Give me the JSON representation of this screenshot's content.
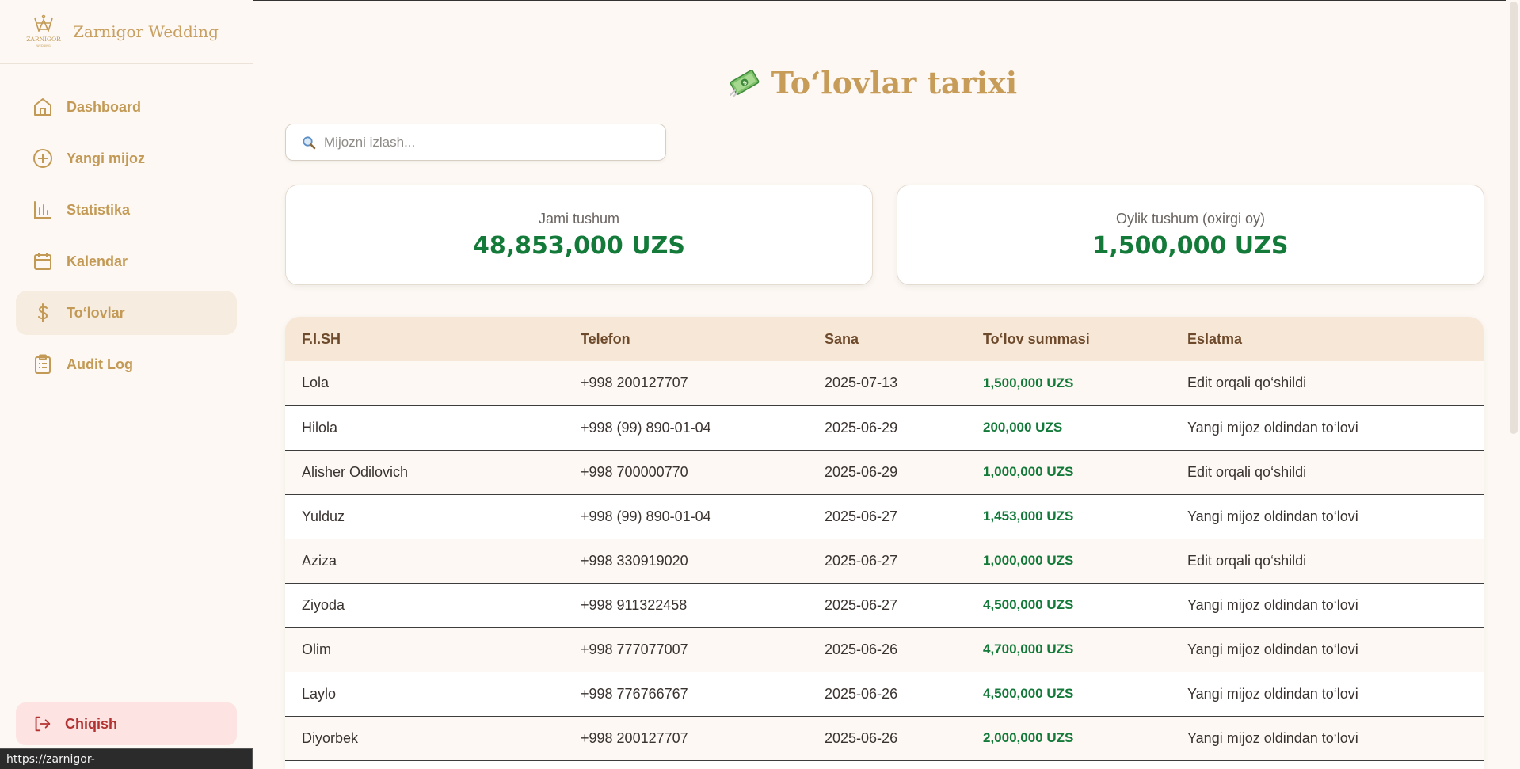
{
  "brand": {
    "name": "Zarnigor Wedding",
    "logo_text": "ZARNIGOR"
  },
  "nav": [
    {
      "label": "Dashboard",
      "icon": "home-icon"
    },
    {
      "label": "Yangi mijoz",
      "icon": "plus-circle-icon"
    },
    {
      "label": "Statistika",
      "icon": "bar-chart-icon"
    },
    {
      "label": "Kalendar",
      "icon": "calendar-icon"
    },
    {
      "label": "To‘lovlar",
      "icon": "dollar-icon",
      "active": true
    },
    {
      "label": "Audit Log",
      "icon": "clipboard-icon"
    }
  ],
  "logout": {
    "label": "Chiqish"
  },
  "status_url": "https://zarnigor-wedding.vercel.app/payments",
  "page": {
    "title": "To‘lovlar tarixi"
  },
  "search": {
    "placeholder": "Mijozni izlash..."
  },
  "stats": {
    "total": {
      "label": "Jami tushum",
      "value": "48,853,000 UZS"
    },
    "monthly": {
      "label": "Oylik tushum (oxirgi oy)",
      "value": "1,500,000 UZS"
    }
  },
  "table": {
    "headers": [
      "F.I.SH",
      "Telefon",
      "Sana",
      "To‘lov summasi",
      "Eslatma"
    ],
    "rows": [
      [
        "Lola",
        "+998 200127707",
        "2025-07-13",
        "1,500,000 UZS",
        "Edit orqali qo‘shildi"
      ],
      [
        "Hilola",
        "+998 (99) 890-01-04",
        "2025-06-29",
        "200,000 UZS",
        "Yangi mijoz oldindan to‘lovi"
      ],
      [
        "Alisher Odilovich",
        "+998 700000770",
        "2025-06-29",
        "1,000,000 UZS",
        "Edit orqali qo‘shildi"
      ],
      [
        "Yulduz",
        "+998 (99) 890-01-04",
        "2025-06-27",
        "1,453,000 UZS",
        "Yangi mijoz oldindan to‘lovi"
      ],
      [
        "Aziza",
        "+998 330919020",
        "2025-06-27",
        "1,000,000 UZS",
        "Edit orqali qo‘shildi"
      ],
      [
        "Ziyoda",
        "+998 911322458",
        "2025-06-27",
        "4,500,000 UZS",
        "Yangi mijoz oldindan to‘lovi"
      ],
      [
        "Olim",
        "+998 777077007",
        "2025-06-26",
        "4,700,000 UZS",
        "Yangi mijoz oldindan to‘lovi"
      ],
      [
        "Laylo",
        "+998 776766767",
        "2025-06-26",
        "4,500,000 UZS",
        "Yangi mijoz oldindan to‘lovi"
      ],
      [
        "Diyorbek",
        "+998 200127707",
        "2025-06-26",
        "2,000,000 UZS",
        "Yangi mijoz oldindan to‘lovi"
      ],
      [
        "",
        "",
        "",
        "",
        ""
      ]
    ]
  },
  "colors": {
    "accent": "#c39a55",
    "amount": "#137a3a",
    "header_bg": "#f7e7d6",
    "logout_bg": "#fde4e2"
  }
}
